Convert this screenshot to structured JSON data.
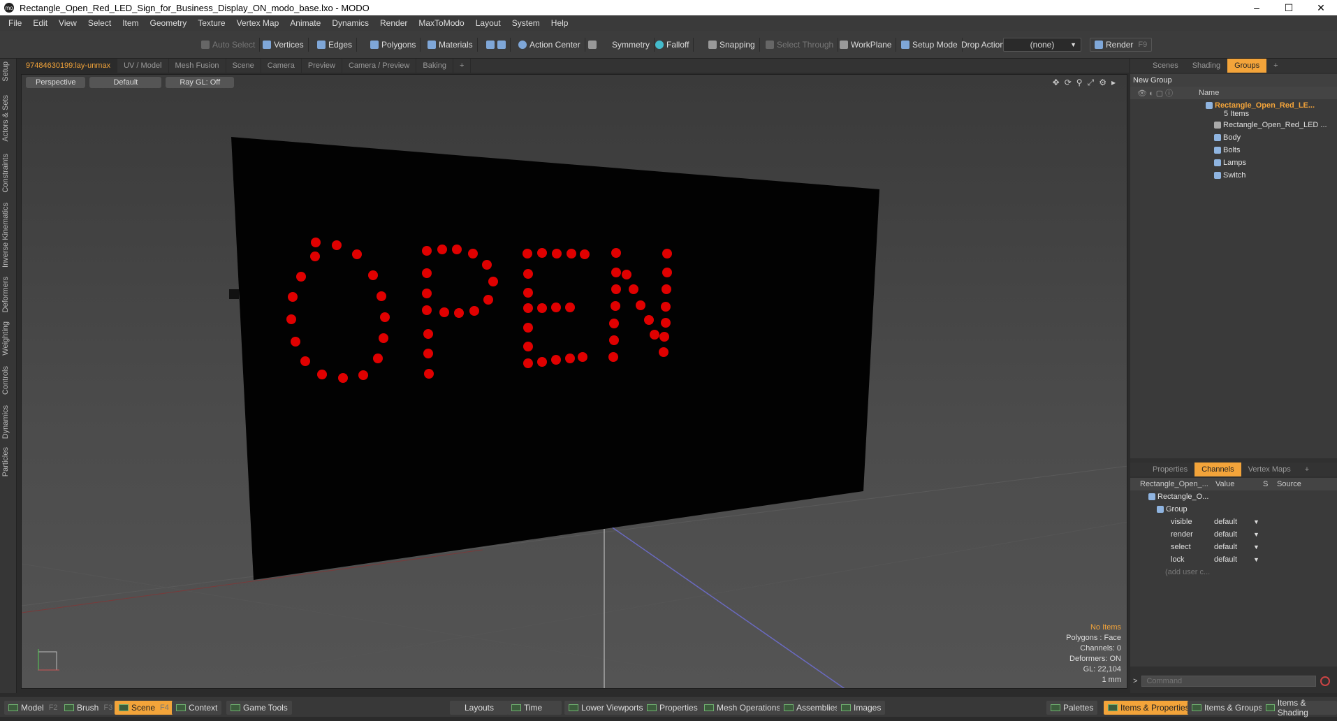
{
  "window": {
    "title": "Rectangle_Open_Red_LED_Sign_for_Business_Display_ON_modo_base.lxo - MODO",
    "logo": "mo",
    "min": "–",
    "max": "☐",
    "close": "✕"
  },
  "menu": [
    "File",
    "Edit",
    "View",
    "Select",
    "Item",
    "Geometry",
    "Texture",
    "Vertex Map",
    "Animate",
    "Dynamics",
    "Render",
    "MaxToModo",
    "Layout",
    "System",
    "Help"
  ],
  "toolbar": {
    "auto_select": "Auto Select",
    "vertices": "Vertices",
    "edges": "Edges",
    "polygons": "Polygons",
    "materials": "Materials",
    "action_center": "Action Center",
    "symmetry": "Symmetry",
    "falloff": "Falloff",
    "snapping": "Snapping",
    "select_through": "Select Through",
    "workplane": "WorkPlane",
    "setup_mode": "Setup Mode",
    "drop_action": "Drop Action",
    "drop_value": "(none)",
    "render": "Render",
    "render_key": "F9"
  },
  "left_tabs": [
    "Setup",
    "Actors & Sets",
    "Constraints",
    "Inverse Kinematics",
    "Deformers",
    "Weighting",
    "Controls",
    "Dynamics",
    "Particles"
  ],
  "viewport_tabs": [
    "97484630199:lay-unmax",
    "UV / Model",
    "Mesh Fusion",
    "Scene",
    "Camera",
    "Preview",
    "Camera / Preview",
    "Baking",
    "+"
  ],
  "viewport": {
    "view": "Perspective",
    "shading": "Default",
    "raygl": "Ray GL: Off",
    "sign_text": "OPEN",
    "led_color": "#e00000"
  },
  "info": {
    "items": "No Items",
    "polygons": "Polygons : Face",
    "channels": "Channels: 0",
    "deformers": "Deformers: ON",
    "gl": "GL: 22,104",
    "unit": "1 mm"
  },
  "right_tabs": [
    "Scenes",
    "Shading",
    "Groups",
    "+"
  ],
  "groups": {
    "new_group": "New Group",
    "name_header": "Name",
    "group_name": "Rectangle_Open_Red_LE...",
    "item_count": "5 Items",
    "children": [
      "Rectangle_Open_Red_LED ...",
      "Body",
      "Bolts",
      "Lamps",
      "Switch"
    ]
  },
  "prop_tabs": [
    "Properties",
    "Channels",
    "Vertex Maps",
    "+"
  ],
  "channels": {
    "header_name": "Rectangle_Open_...",
    "header_value": "Value",
    "header_s": "S",
    "header_source": "Source",
    "item": "Rectangle_O...",
    "group": "Group",
    "rows": [
      {
        "name": "visible",
        "value": "default"
      },
      {
        "name": "render",
        "value": "default"
      },
      {
        "name": "select",
        "value": "default"
      },
      {
        "name": "lock",
        "value": "default"
      }
    ],
    "add_user": "(add user c..."
  },
  "command": {
    "prompt": ">",
    "placeholder": "Command"
  },
  "status": {
    "model": "Model",
    "model_key": "F2",
    "brush": "Brush",
    "brush_key": "F3",
    "scene": "Scene",
    "scene_key": "F4",
    "context": "Context",
    "game_tools": "Game Tools",
    "layouts": "Layouts",
    "time": "Time",
    "lower_viewports": "Lower Viewports",
    "properties": "Properties",
    "mesh_ops": "Mesh Operations",
    "assemblies": "Assemblies",
    "images": "Images",
    "palettes": "Palettes",
    "items_props": "Items & Properties",
    "items_groups": "Items & Groups",
    "items_shading": "Items & Shading"
  }
}
